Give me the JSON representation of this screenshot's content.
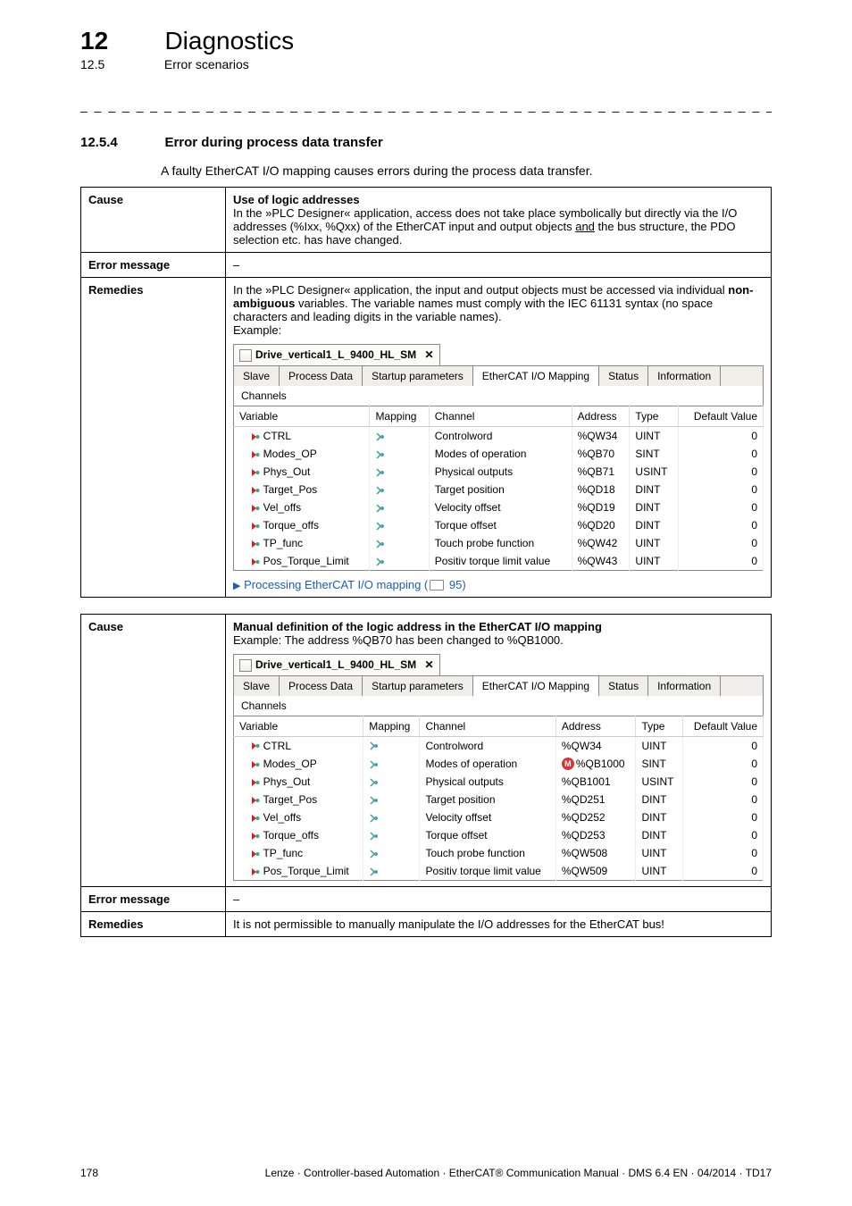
{
  "header": {
    "chapter_num": "12",
    "chapter_title": "Diagnostics",
    "section_num": "12.5",
    "section_title": "Error scenarios"
  },
  "section": {
    "num": "12.5.4",
    "title": "Error during process data transfer",
    "intro": "A faulty EtherCAT I/O mapping causes errors during the process data transfer."
  },
  "labels": {
    "cause": "Cause",
    "errmsg": "Error message",
    "remedies": "Remedies",
    "tab_title": "Drive_vertical1_L_9400_HL_SM",
    "close_x": "✕",
    "tabs": {
      "slave": "Slave",
      "process": "Process Data",
      "startup": "Startup parameters",
      "iomap": "EtherCAT I/O Mapping",
      "status": "Status",
      "info": "Information"
    },
    "channels": "Channels",
    "cols": {
      "variable": "Variable",
      "mapping": "Mapping",
      "channel": "Channel",
      "address": "Address",
      "type": "Type",
      "defval": "Default Value"
    }
  },
  "block1": {
    "cause_title": "Use of logic addresses",
    "cause_body1": "In the »PLC Designer« application, access does not take place symbolically but directly via the I/O addresses (%Ixx, %Qxx) of the EtherCAT input and output objects ",
    "cause_body_and": "and",
    "cause_body2": " the bus structure, the PDO selection etc. has have changed.",
    "errmsg": "–",
    "rem_body1": "In the »PLC Designer« application, the input and output objects must be accessed via individual ",
    "rem_bold": "non-ambiguous",
    "rem_body2": " variables. The variable names must comply with the IEC 61131 syntax (no space characters and leading digits in the variable names).",
    "rem_example": "Example:",
    "rows": [
      {
        "var": "CTRL",
        "chan": "Controlword",
        "addr": "%QW34",
        "type": "UINT",
        "def": "0"
      },
      {
        "var": "Modes_OP",
        "chan": "Modes of operation",
        "addr": "%QB70",
        "type": "SINT",
        "def": "0"
      },
      {
        "var": "Phys_Out",
        "chan": "Physical outputs",
        "addr": "%QB71",
        "type": "USINT",
        "def": "0"
      },
      {
        "var": "Target_Pos",
        "chan": "Target position",
        "addr": "%QD18",
        "type": "DINT",
        "def": "0"
      },
      {
        "var": "Vel_offs",
        "chan": "Velocity offset",
        "addr": "%QD19",
        "type": "DINT",
        "def": "0"
      },
      {
        "var": "Torque_offs",
        "chan": "Torque offset",
        "addr": "%QD20",
        "type": "DINT",
        "def": "0"
      },
      {
        "var": "TP_func",
        "chan": "Touch probe function",
        "addr": "%QW42",
        "type": "UINT",
        "def": "0"
      },
      {
        "var": "Pos_Torque_Limit",
        "chan": "Positiv torque limit value",
        "addr": "%QW43",
        "type": "UINT",
        "def": "0"
      }
    ],
    "link_text": "Processing EtherCAT I/O mapping",
    "link_page": " 95)"
  },
  "block2": {
    "cause_title": "Manual definition of the logic address in the EtherCAT I/O mapping",
    "cause_ex": "Example: The address %QB70 has been changed to %QB1000.",
    "rows": [
      {
        "var": "CTRL",
        "chan": "Controlword",
        "addr": "%QW34",
        "type": "UINT",
        "def": "0",
        "mark": false
      },
      {
        "var": "Modes_OP",
        "chan": "Modes of operation",
        "addr": "%QB1000",
        "type": "SINT",
        "def": "0",
        "mark": true
      },
      {
        "var": "Phys_Out",
        "chan": "Physical outputs",
        "addr": "%QB1001",
        "type": "USINT",
        "def": "0",
        "mark": false
      },
      {
        "var": "Target_Pos",
        "chan": "Target position",
        "addr": "%QD251",
        "type": "DINT",
        "def": "0",
        "mark": false
      },
      {
        "var": "Vel_offs",
        "chan": "Velocity offset",
        "addr": "%QD252",
        "type": "DINT",
        "def": "0",
        "mark": false
      },
      {
        "var": "Torque_offs",
        "chan": "Torque offset",
        "addr": "%QD253",
        "type": "DINT",
        "def": "0",
        "mark": false
      },
      {
        "var": "TP_func",
        "chan": "Touch probe function",
        "addr": "%QW508",
        "type": "UINT",
        "def": "0",
        "mark": false
      },
      {
        "var": "Pos_Torque_Limit",
        "chan": "Positiv torque limit value",
        "addr": "%QW509",
        "type": "UINT",
        "def": "0",
        "mark": false
      }
    ],
    "errmsg": "–",
    "remedies": "It is not permissible to manually manipulate the I/O addresses for the EtherCAT bus!"
  },
  "footer": {
    "page": "178",
    "line": "Lenze · Controller-based Automation · EtherCAT® Communication Manual · DMS 6.4 EN · 04/2014 · TD17"
  }
}
